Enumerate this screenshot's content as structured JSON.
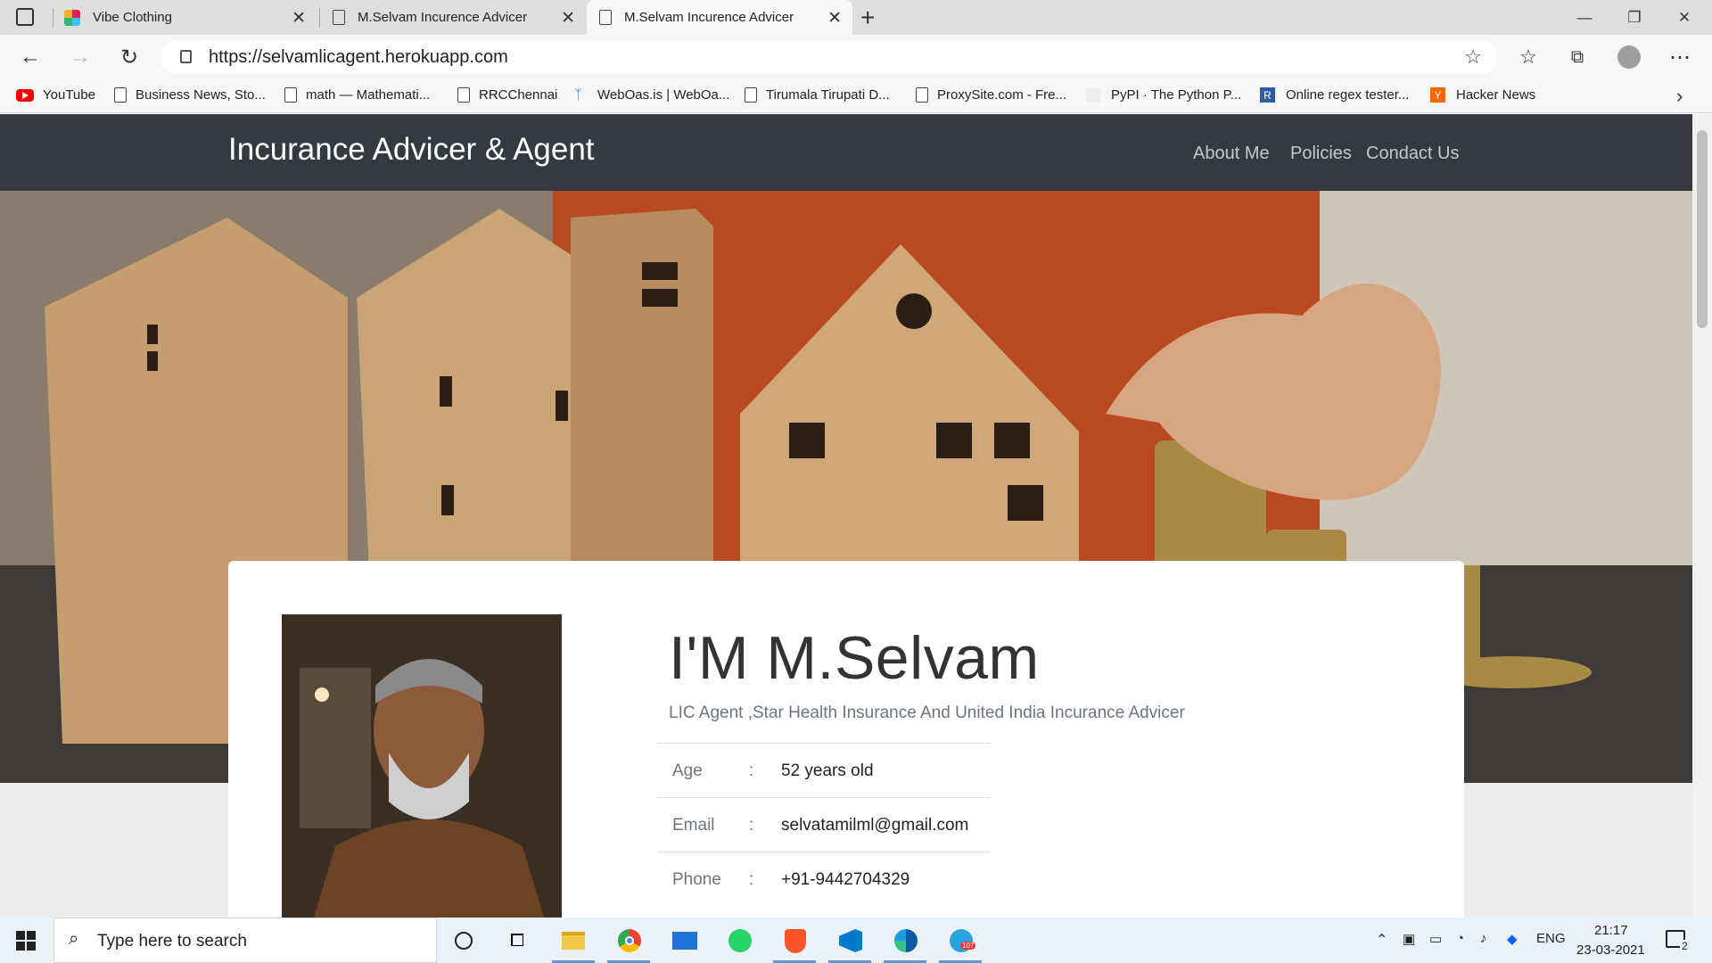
{
  "browser": {
    "tabs": [
      {
        "label": "Vibe Clothing",
        "active": false
      },
      {
        "label": "M.Selvam Incurence Advicer",
        "active": false
      },
      {
        "label": "M.Selvam Incurence Advicer",
        "active": true
      }
    ],
    "new_tab": "+",
    "url": "https://selvamlicagent.herokuapp.com",
    "bookmarks": [
      "YouTube",
      "Business News, Sto...",
      "math — Mathemati...",
      "RRCChennai",
      "WebOas.is | WebOa...",
      "Tirumala Tirupati D...",
      "ProxySite.com - Fre...",
      "PyPI · The Python P...",
      "Online regex tester...",
      "Hacker News"
    ]
  },
  "site": {
    "brand": "Incurance Advicer & Agent",
    "nav": [
      "About Me",
      "Policies",
      "Condact Us"
    ],
    "profile": {
      "name": "I'M M.Selvam",
      "subtitle": "LIC Agent ,Star Health Insurance And United India Incurance Advicer",
      "rows": [
        {
          "key": "Age",
          "sep": ":",
          "value": "52 years old"
        },
        {
          "key": "Email",
          "sep": ":",
          "value": "selvatamilml@gmail.com"
        },
        {
          "key": "Phone",
          "sep": ":",
          "value": "+91-9442704329"
        }
      ]
    }
  },
  "taskbar": {
    "search_placeholder": "Type here to search",
    "lang": "ENG",
    "time": "21:17",
    "date": "23-03-2021",
    "notification_count": "2",
    "telegram_badge": "107"
  },
  "colors": {
    "navbar": "#343a40",
    "youtube": "#ff0000",
    "hacker_news": "#ff6600",
    "brave": "#fb542b",
    "vscode": "#007acc"
  }
}
